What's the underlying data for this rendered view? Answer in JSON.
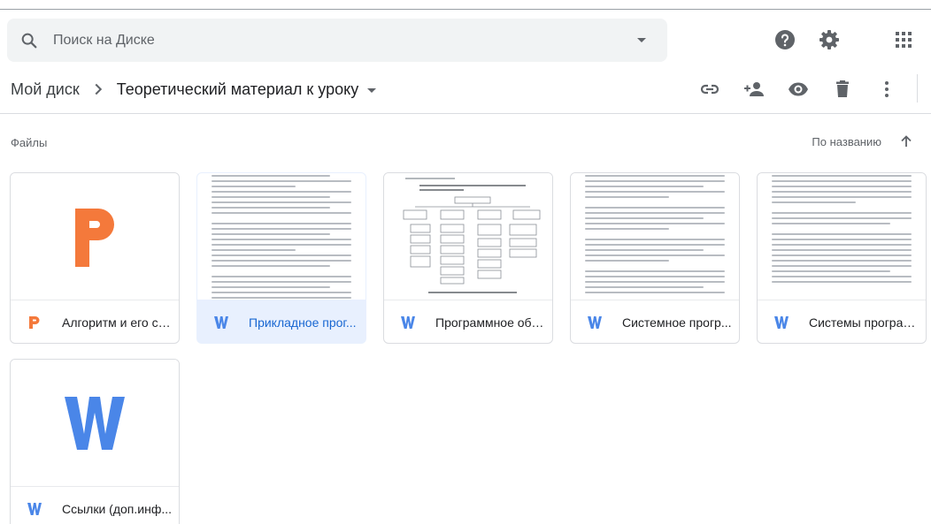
{
  "search": {
    "placeholder": "Поиск на Диске"
  },
  "breadcrumb": {
    "root": "Мой диск",
    "current": "Теоретический материал к уроку"
  },
  "files_section": {
    "title": "Файлы",
    "sort_label": "По названию"
  },
  "files": [
    {
      "name": "Алгоритм и его св...",
      "type": "pptx",
      "selected": false
    },
    {
      "name": "Прикладное прог...",
      "type": "docx",
      "selected": true
    },
    {
      "name": "Программное обе...",
      "type": "docx",
      "selected": false
    },
    {
      "name": "Системное прогр...",
      "type": "docx",
      "selected": false
    },
    {
      "name": "Системы програм...",
      "type": "docx",
      "selected": false
    },
    {
      "name": "Ссылки (доп.инф...",
      "type": "docx",
      "selected": false
    }
  ],
  "colors": {
    "word_blue": "#4a86e8",
    "presentation_orange": "#f4793b",
    "icon_gray": "#5f6368",
    "selected_bg": "#e8f0fe"
  },
  "icons": [
    "search-icon",
    "help-icon",
    "settings-icon",
    "apps-grid-icon",
    "link-icon",
    "add-person-icon",
    "preview-icon",
    "trash-icon",
    "more-vert-icon"
  ]
}
